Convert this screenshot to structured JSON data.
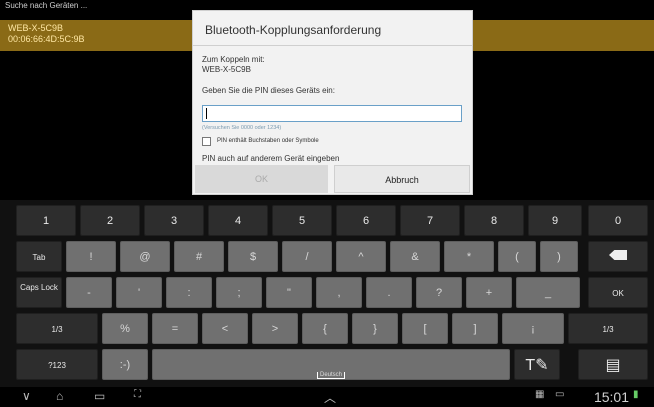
{
  "app": {
    "search_label": "Suche nach Geräten ...",
    "device_name": "WEB-X-5C9B",
    "device_mac": "00:06:66:4D:5C:9B"
  },
  "dialog": {
    "title": "Bluetooth-Kopplungsanforderung",
    "pair_with_label": "Zum Koppeln mit:",
    "pair_device": "WEB-X-5C9B",
    "pin_prompt": "Geben Sie die PIN dieses Geräts ein:",
    "pin_value": "",
    "pin_hint": "(Versuchen Sie 0000 oder 1234)",
    "letters_checkbox_label": "PIN enthält Buchstaben oder Symbole",
    "other_device_label": "PIN auch auf anderem Gerät eingeben",
    "ok_label": "OK",
    "cancel_label": "Abbruch"
  },
  "keyboard": {
    "row1": [
      "1",
      "2",
      "3",
      "4",
      "5",
      "6",
      "7",
      "8",
      "9",
      "0"
    ],
    "row2": [
      "Tab",
      "!",
      "@",
      "#",
      "$",
      "/",
      "^",
      "&",
      "*",
      "(",
      ")"
    ],
    "row3": [
      "Caps Lock",
      "-",
      "'",
      ":",
      ";",
      "\"",
      ",",
      ".",
      "?",
      "+",
      "_",
      "OK"
    ],
    "row4": [
      "1/3",
      "%",
      "=",
      "<",
      ">",
      "{",
      "}",
      "[",
      "]",
      "¡",
      "1/3"
    ],
    "row5": [
      "?123",
      ":-)",
      "Deutsch"
    ]
  },
  "status": {
    "time": "15:01"
  }
}
